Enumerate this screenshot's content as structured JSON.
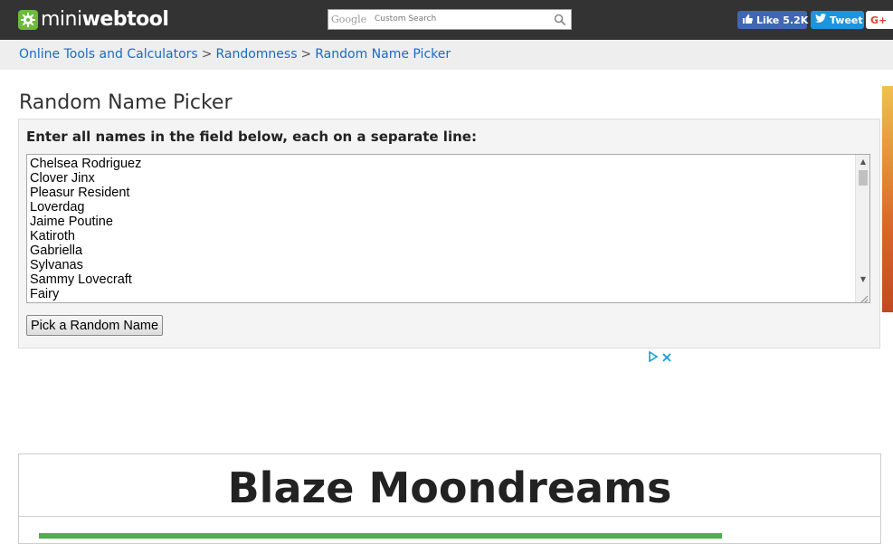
{
  "header": {
    "logo_text_light": "mini",
    "logo_text_bold": "webtool",
    "logo_icon": "gear-icon",
    "search": {
      "brand": "Google",
      "placeholder": "Custom Search",
      "icon": "search-icon"
    },
    "social": {
      "like_label": "Like",
      "like_count": "5.2K",
      "tweet_label": "Tweet",
      "gplus_label": "G+"
    }
  },
  "breadcrumb": {
    "items": [
      "Online Tools and Calculators",
      "Randomness",
      "Random Name Picker"
    ],
    "separator": ">"
  },
  "page": {
    "title": "Random Name Picker",
    "instruction": "Enter all names in the field below, each on a separate line:",
    "names": [
      "Chelsea Rodriguez",
      "Clover Jinx",
      "Pleasur Resident",
      "Loverdag",
      "Jaime Poutine",
      "Katiroth",
      "Gabriella",
      "Sylvanas",
      "Sammy Lovecraft",
      "Fairy"
    ],
    "pick_button": "Pick a Random Name"
  },
  "result": {
    "name": "Blaze Moondreams",
    "progress_fraction": 0.83
  },
  "colors": {
    "topbar": "#333333",
    "logo_green": "#6cbb3c",
    "link": "#1a6bc4",
    "facebook": "#4267b2",
    "twitter": "#1b95e0",
    "progress": "#4caf50"
  }
}
